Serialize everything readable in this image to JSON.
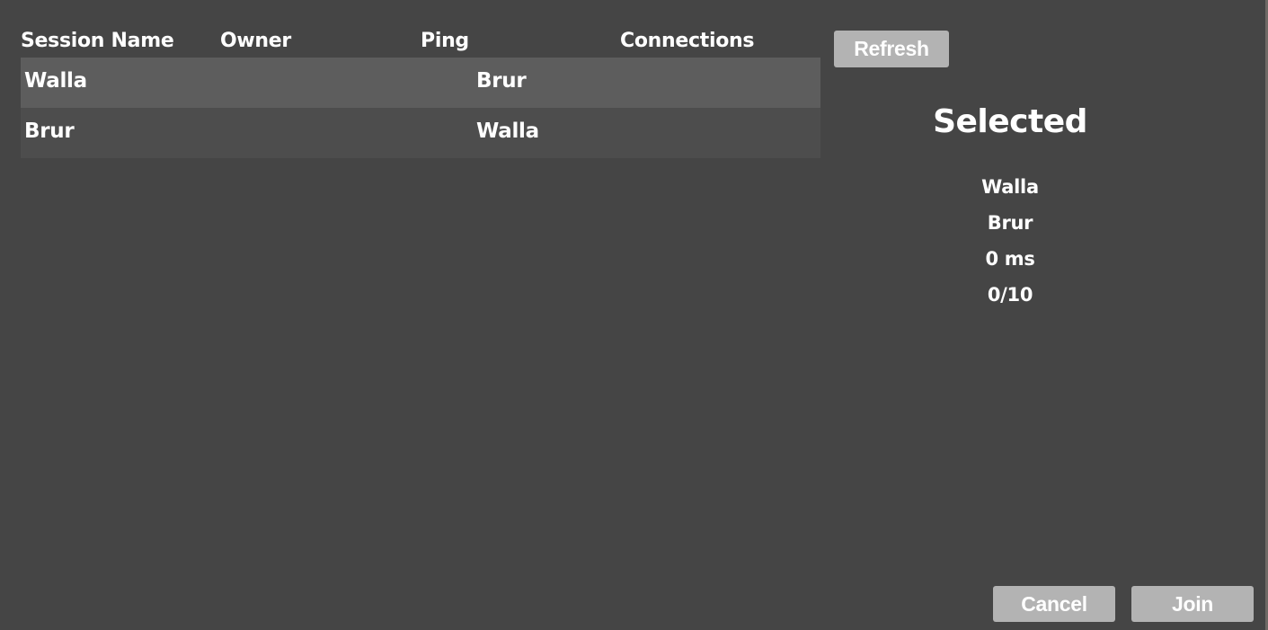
{
  "table": {
    "headers": {
      "session_name": "Session Name",
      "owner": "Owner",
      "ping": "Ping",
      "connections": "Connections"
    },
    "rows": [
      {
        "session_name": "Walla",
        "owner": "Brur",
        "selected": true
      },
      {
        "session_name": "Brur",
        "owner": "Walla",
        "selected": false
      }
    ]
  },
  "buttons": {
    "refresh": "Refresh",
    "cancel": "Cancel",
    "join": "Join"
  },
  "selected": {
    "title": "Selected",
    "session_name": "Walla",
    "owner": "Brur",
    "ping": "0 ms",
    "connections": "0/10"
  },
  "colors": {
    "background": "#454545",
    "row_selected": "#5d5d5d",
    "row_default": "#4d4d4d",
    "button": "#b3b3b3",
    "text": "#ffffff"
  }
}
